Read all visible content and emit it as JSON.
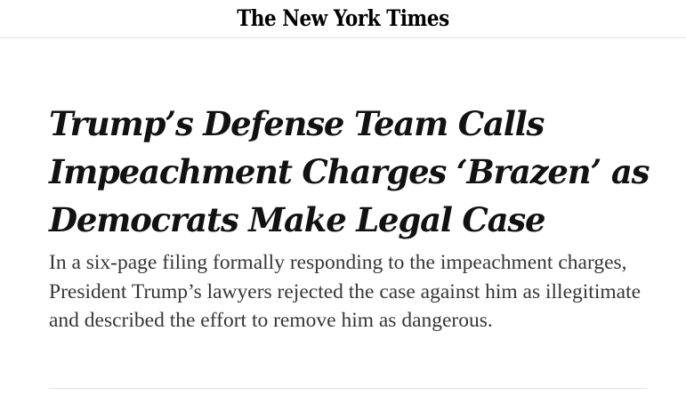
{
  "header": {
    "masthead": "The New York Times"
  },
  "article": {
    "headline": "Trump’s Defense Team Calls Impeachment Charges ‘Brazen’ as Democrats Make Legal Case",
    "summary": "In a six-page filing formally responding to the impeachment charges, President Trump’s lawyers rejected the case against him as illegitimate and described the effort to remove him as dangerous."
  }
}
